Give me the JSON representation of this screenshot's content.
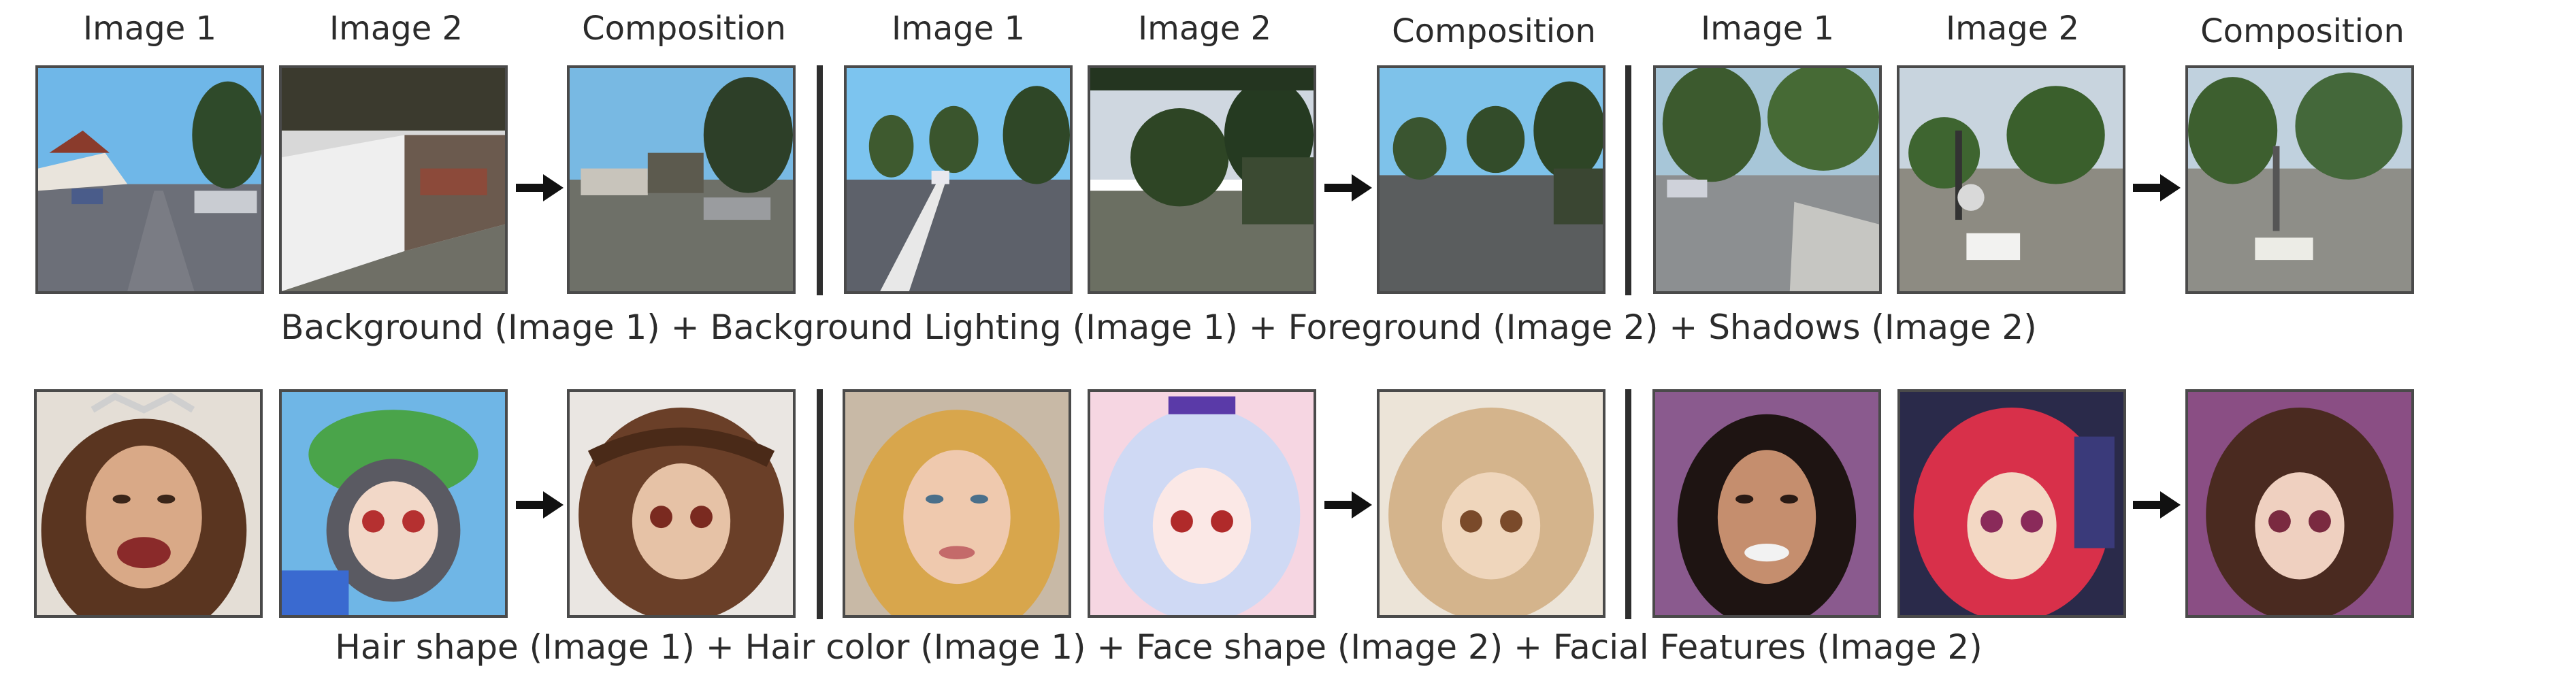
{
  "top_row": {
    "groups": [
      {
        "labels": [
          "Image 1",
          "Image 2",
          "Composition"
        ]
      },
      {
        "labels": [
          "Image 1",
          "Image 2",
          "Composition"
        ]
      },
      {
        "labels": [
          "Image 1",
          "Image 2",
          "Composition"
        ]
      }
    ],
    "caption": "Background (Image 1) + Background Lighting (Image 1) + Foreground (Image 2) + Shadows (Image 2)"
  },
  "bottom_row": {
    "caption": "Hair shape (Image 1) + Hair color (Image 1) + Face shape (Image 2)  + Facial Features (Image 2)"
  }
}
